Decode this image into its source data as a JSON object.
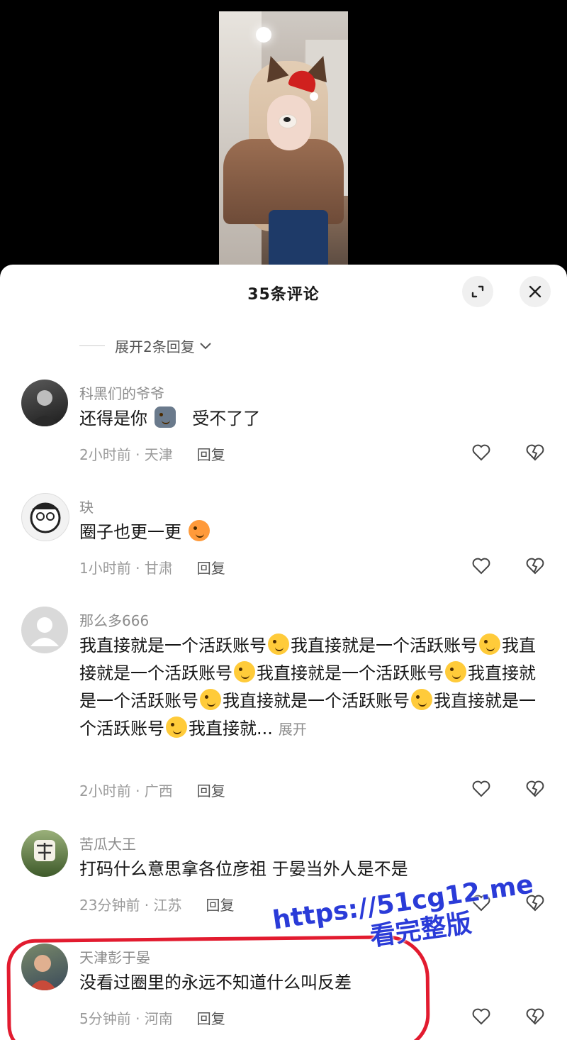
{
  "sheet": {
    "title": "35条评论",
    "expand_replies": "展开2条回复"
  },
  "comments": [
    {
      "user": "科黑们的爷爷",
      "text_a": "还得是你",
      "text_b": "受不了了",
      "time": "2小时前 · 天津",
      "reply": "回复"
    },
    {
      "user": "玦",
      "text": "圈子也更一更",
      "time": "1小时前 · 甘肃",
      "reply": "回复"
    },
    {
      "user": "那么多666",
      "segment": "我直接就是一个活跃账号",
      "last_segment": "我直接就...",
      "more": "展开",
      "time": "2小时前 · 广西",
      "reply": "回复"
    },
    {
      "user": "苦瓜大王",
      "text": "打码什么意思拿各位彦祖 于晏当外人是不是",
      "time": "23分钟前 · 江苏",
      "reply": "回复"
    },
    {
      "user": "天津彭于晏",
      "text": "没看过圈里的永远不知道什么叫反差",
      "time": "5分钟前 · 河南",
      "reply": "回复"
    }
  ],
  "watermark": {
    "url": "https://51cg12.me",
    "tag": "看完整版"
  },
  "colors": {
    "highlight": "#e21b2f",
    "watermark": "#2a3bd8"
  },
  "icons": [
    "expand-icon",
    "close-icon",
    "chevron-down-icon",
    "heart-icon",
    "broken-heart-icon"
  ]
}
